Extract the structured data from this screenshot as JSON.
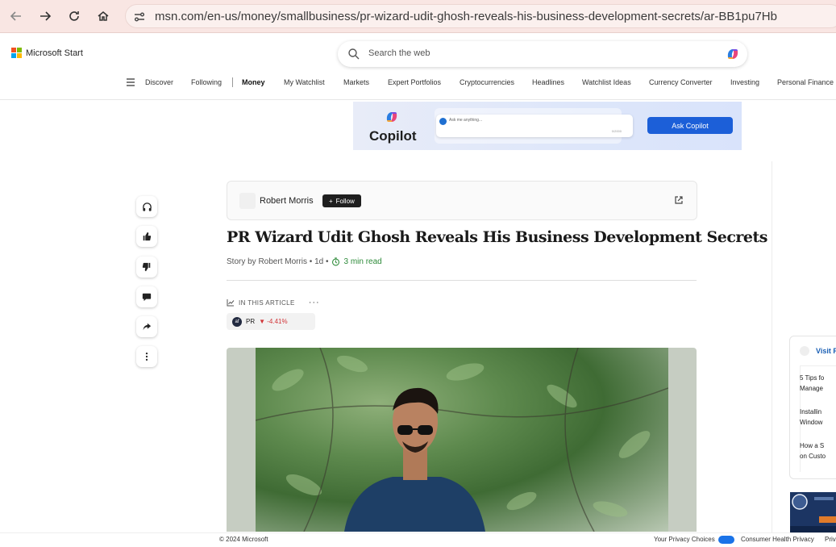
{
  "browser": {
    "url": "msn.com/en-us/money/smallbusiness/pr-wizard-udit-ghosh-reveals-his-business-development-secrets/ar-BB1pu7Hb"
  },
  "header": {
    "brand": "Microsoft Start",
    "search_placeholder": "Search the web"
  },
  "nav": {
    "items": [
      "Discover",
      "Following",
      "Money",
      "My Watchlist",
      "Markets",
      "Expert Portfolios",
      "Cryptocurrencies",
      "Headlines",
      "Watchlist Ideas",
      "Currency Converter",
      "Investing",
      "Personal Finance"
    ],
    "active": "Money"
  },
  "ad": {
    "brand": "Copilot",
    "prompt_placeholder": "Ask me anything...",
    "counter": "0/2000",
    "button": "Ask Copilot"
  },
  "article": {
    "author": "Robert Morris",
    "follow_label": "Follow",
    "title": "PR Wizard Udit Ghosh Reveals His Business Development Secrets",
    "byline": "Story by Robert Morris • 1d •",
    "read_time": "3 min read",
    "in_this_article": "IN THIS ARTICLE",
    "more": "···",
    "stock": {
      "symbol": "PR",
      "change": "▼ -4.41%"
    }
  },
  "right_rail": {
    "visit_label": "Visit R",
    "items": [
      [
        "5 Tips fo",
        "Manage"
      ],
      [
        "Installin",
        "Window"
      ],
      [
        "How a S",
        "on Custo"
      ]
    ]
  },
  "footer": {
    "copyright": "© 2024 Microsoft",
    "privacy_choices": "Your Privacy Choices",
    "consumer_health": "Consumer Health Privacy",
    "privacy": "Priv"
  },
  "colors": {
    "chrome_bg": "#f9e6e3",
    "accent_blue": "#1c5fd8",
    "negative": "#d13438",
    "read_time": "#2e8b3a"
  }
}
